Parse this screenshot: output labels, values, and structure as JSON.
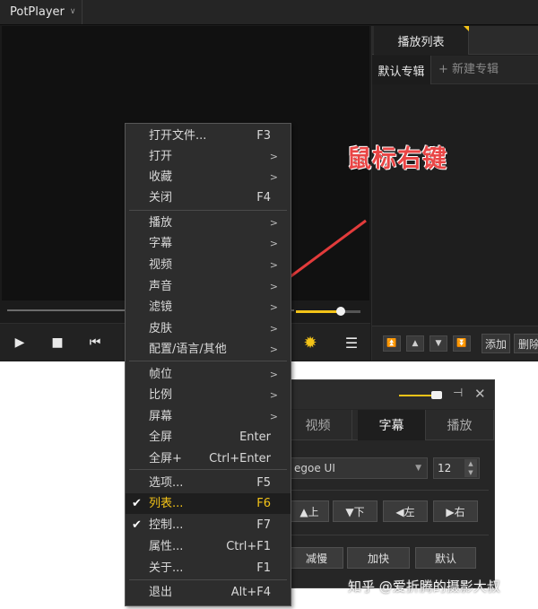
{
  "app": {
    "title": "PotPlayer"
  },
  "playlist": {
    "tab": "播放列表",
    "default_album": "默认专辑",
    "new_album": "+ 新建专辑",
    "add": "添加",
    "delete": "删除"
  },
  "annotation": "鼠标右键",
  "context_menu": [
    {
      "label": "打开文件...",
      "shortcut": "F3"
    },
    {
      "label": "打开",
      "submenu": ">"
    },
    {
      "label": "收藏",
      "submenu": ">"
    },
    {
      "label": "关闭",
      "shortcut": "F4"
    },
    {
      "label": "播放",
      "submenu": ">"
    },
    {
      "label": "字幕",
      "submenu": ">"
    },
    {
      "label": "视频",
      "submenu": ">"
    },
    {
      "label": "声音",
      "submenu": ">"
    },
    {
      "label": "滤镜",
      "submenu": ">"
    },
    {
      "label": "皮肤",
      "submenu": ">"
    },
    {
      "label": "配置/语言/其他",
      "submenu": ">"
    },
    {
      "label": "帧位",
      "submenu": ">"
    },
    {
      "label": "比例",
      "submenu": ">"
    },
    {
      "label": "屏幕",
      "submenu": ">"
    },
    {
      "label": "全屏",
      "shortcut": "Enter"
    },
    {
      "label": "全屏+",
      "shortcut": "Ctrl+Enter"
    },
    {
      "label": "选项...",
      "shortcut": "F5"
    },
    {
      "label": "列表...",
      "shortcut": "F6",
      "checked": "✔"
    },
    {
      "label": "控制...",
      "shortcut": "F7",
      "checked": "✔"
    },
    {
      "label": "属性...",
      "shortcut": "Ctrl+F1"
    },
    {
      "label": "关于...",
      "shortcut": "F1"
    },
    {
      "label": "退出",
      "shortcut": "Alt+F4"
    }
  ],
  "control_panel": {
    "tabs": [
      "视频",
      "字幕",
      "播放"
    ],
    "active_tab": "字幕",
    "font": "egoe UI",
    "font_size": "12",
    "position_buttons": [
      "▲上",
      "▼下",
      "◀左",
      "▶右"
    ],
    "speed_buttons": [
      "减慢",
      "加快",
      "默认"
    ]
  },
  "watermark": "知乎 @爱折腾的摄影大叔",
  "volume": 0.7,
  "colors": {
    "accent": "#f3c318",
    "annotation": "#e94545",
    "menu_bg": "#2d2d2d"
  }
}
